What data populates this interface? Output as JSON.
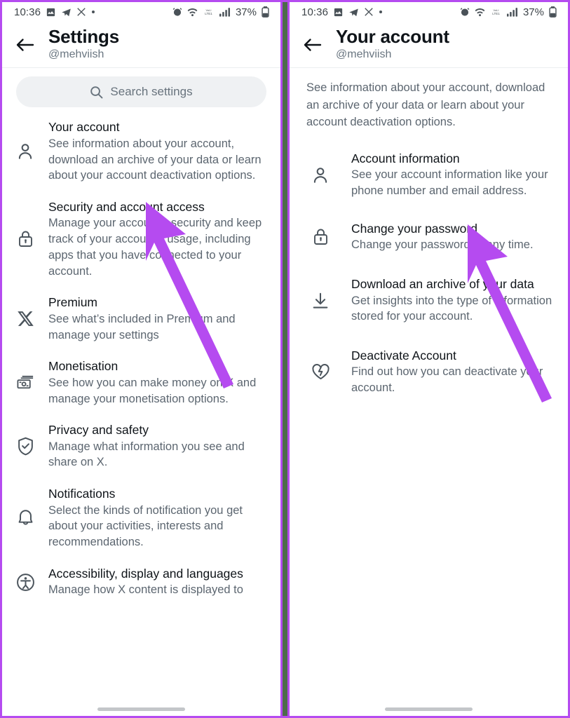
{
  "status_bar": {
    "time": "10:36",
    "battery_text": "37%",
    "network_label": "VoLTE1",
    "left_icons": [
      "image-icon",
      "telegram-icon",
      "x-icon",
      "dot-icon"
    ],
    "right_icons": [
      "alarm-icon",
      "wifi-icon",
      "volte-icon",
      "signal-icon",
      "battery-icon"
    ]
  },
  "colors": {
    "annotation_arrow": "#b54bf0",
    "frame_border": "#b54bf0",
    "panel_gap": "#4d6b4a",
    "text_primary": "#0f1419",
    "text_secondary": "#5c6670",
    "search_background": "#eff1f3"
  },
  "left_panel": {
    "header": {
      "back_icon": "arrow-left-icon",
      "title": "Settings",
      "subtitle": "@mehviish"
    },
    "search": {
      "icon": "search-icon",
      "placeholder": "Search settings",
      "value": ""
    },
    "items": [
      {
        "icon": "person-icon",
        "title": "Your account",
        "desc": "See information about your account, download an archive of your data or learn about your account deactivation options."
      },
      {
        "icon": "lock-icon",
        "title": "Security and account access",
        "desc": "Manage your account’s security and keep track of your account’s usage, including apps that you have connected to your account."
      },
      {
        "icon": "x-logo-icon",
        "title": "Premium",
        "desc": "See what’s included in Premium and manage your settings"
      },
      {
        "icon": "money-icon",
        "title": "Monetisation",
        "desc": "See how you can make money on X and manage your monetisation options."
      },
      {
        "icon": "shield-check-icon",
        "title": "Privacy and safety",
        "desc": "Manage what information you see and share on X."
      },
      {
        "icon": "bell-icon",
        "title": "Notifications",
        "desc": "Select the kinds of notification you get about your activities, interests and recommendations."
      },
      {
        "icon": "accessibility-icon",
        "title": "Accessibility, display and languages",
        "desc": "Manage how X content is displayed to"
      }
    ]
  },
  "right_panel": {
    "header": {
      "back_icon": "arrow-left-icon",
      "title": "Your account",
      "subtitle": "@mehviish"
    },
    "blurb": "See information about your account, download an archive of your data or learn about your account deactivation options.",
    "items": [
      {
        "icon": "person-icon",
        "title": "Account information",
        "desc": "See your account information like your phone number and email address."
      },
      {
        "icon": "lock-icon",
        "title": "Change your password",
        "desc": "Change your password at any time."
      },
      {
        "icon": "download-icon",
        "title": "Download an archive of your data",
        "desc": "Get insights into the type of information stored for your account."
      },
      {
        "icon": "broken-heart-icon",
        "title": "Deactivate Account",
        "desc": "Find out how you can deactivate your account."
      }
    ]
  },
  "annotations": [
    {
      "name": "arrow-pointing-to-your-account",
      "panel": "left"
    },
    {
      "name": "arrow-pointing-to-change-your-password",
      "panel": "right"
    }
  ]
}
